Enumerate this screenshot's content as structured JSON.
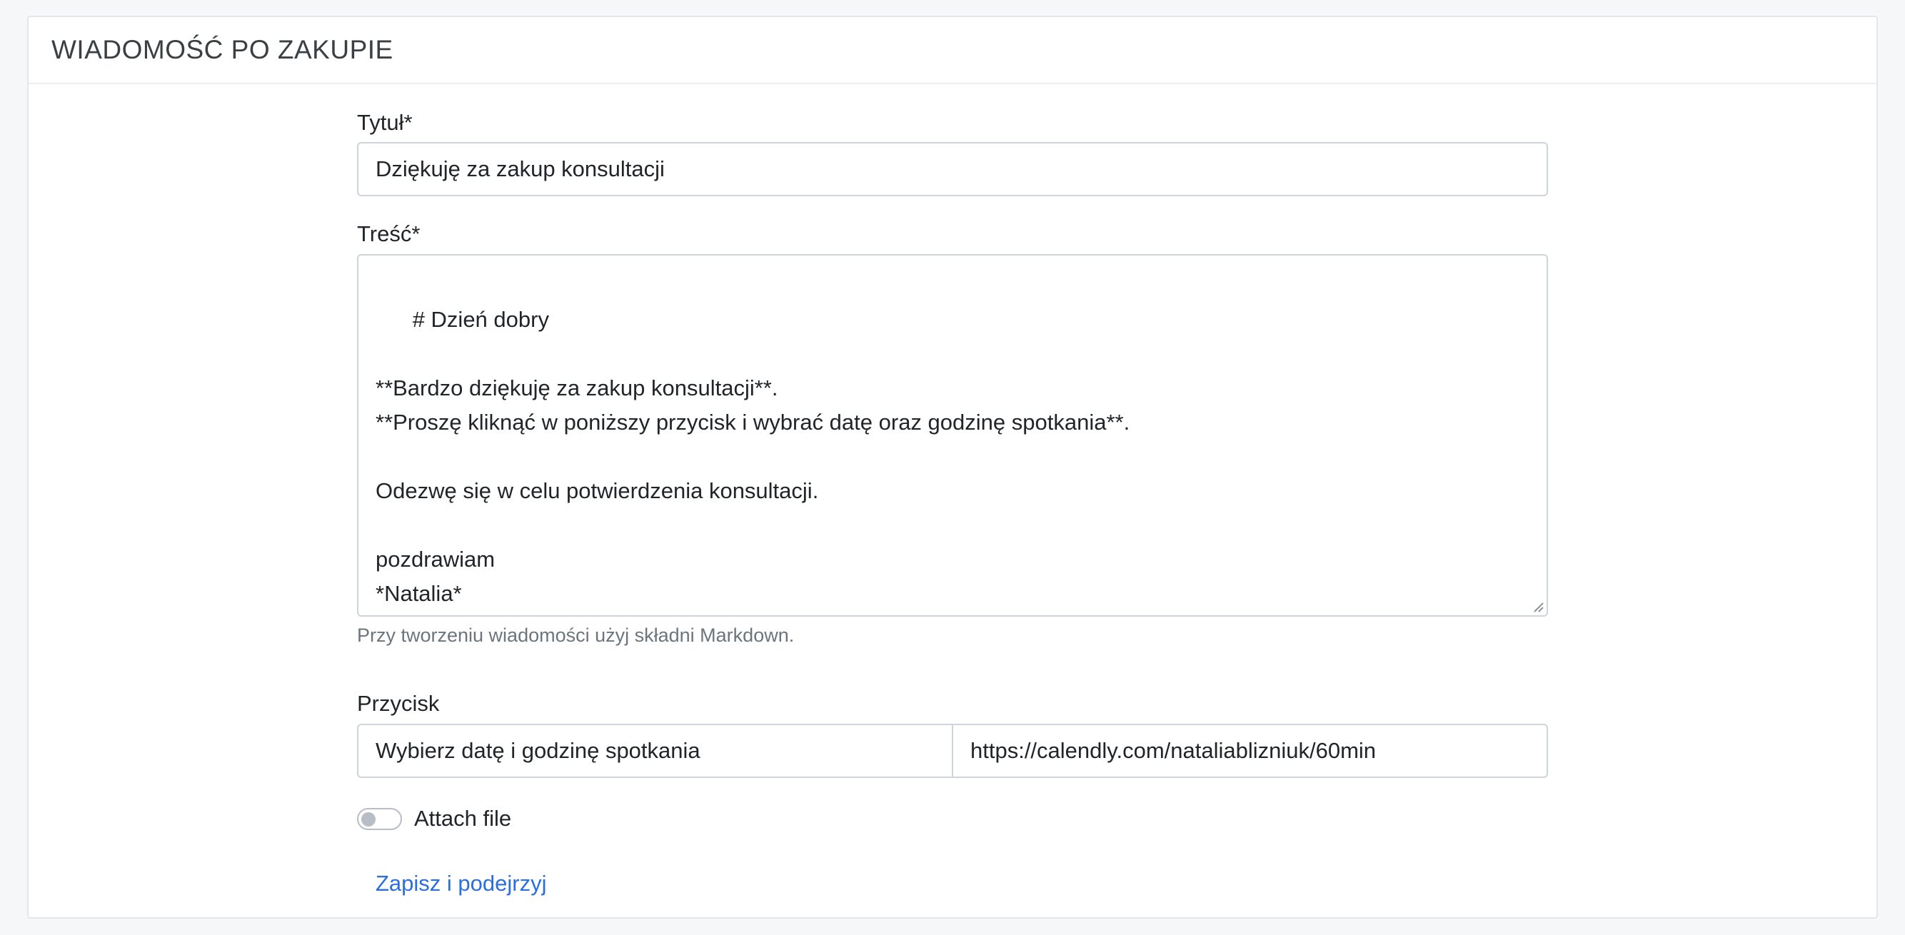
{
  "card": {
    "title": "WIADOMOŚĆ PO ZAKUPIE"
  },
  "form": {
    "title_field": {
      "label": "Tytuł*",
      "value": "Dziękuję za zakup konsultacji"
    },
    "content_field": {
      "label": "Treść*",
      "value": "# Dzień dobry\n\n**Bardzo dziękuję za zakup konsultacji**.\n**Proszę kliknąć w poniższy przycisk i wybrać datę oraz godzinę spotkania**.\n\nOdezwę się w celu potwierdzenia konsultacji.\n\npozdrawiam\n*Natalia*",
      "help": "Przy tworzeniu wiadomości użyj składni Markdown."
    },
    "button_field": {
      "label": "Przycisk",
      "text_value": "Wybierz datę i godzinę spotkania",
      "url_value": "https://calendly.com/nataliablizniuk/60min"
    },
    "attach_file": {
      "label": "Attach file",
      "enabled": false
    },
    "save_preview_label": "Zapisz i podejrzyj"
  },
  "colors": {
    "link": "#2a6fdb",
    "border": "#ced4da",
    "background": "#f6f7f9"
  }
}
